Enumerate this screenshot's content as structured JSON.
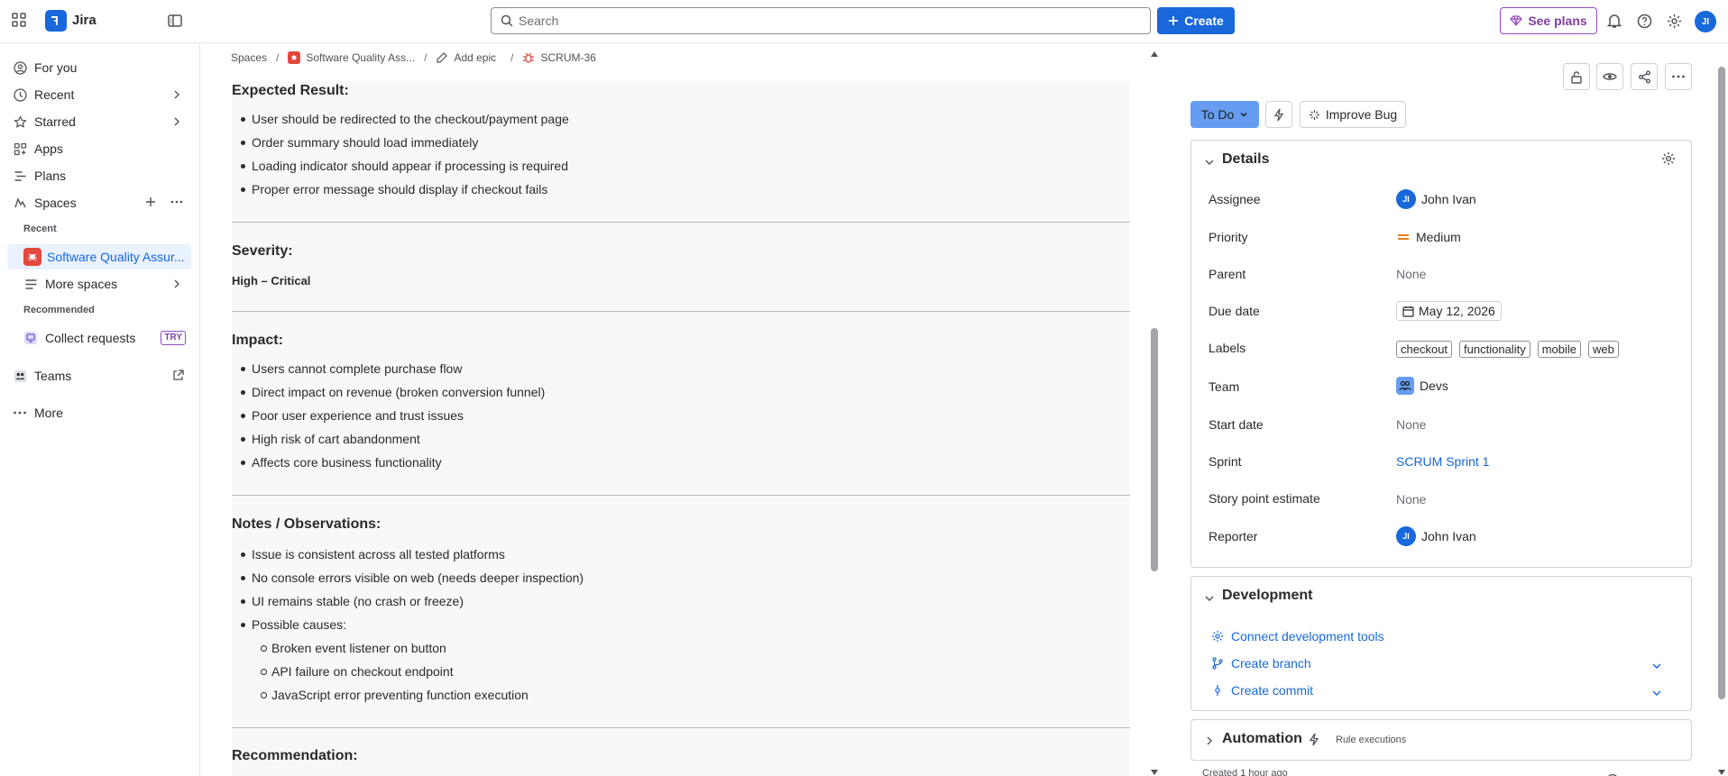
{
  "app": {
    "name": "Jira"
  },
  "topbar": {
    "search_placeholder": "Search",
    "create_label": "Create",
    "plans_label": "See plans",
    "avatar_initials": "JI"
  },
  "sidebar": {
    "for_you": "For you",
    "recent": "Recent",
    "starred": "Starred",
    "apps": "Apps",
    "plans": "Plans",
    "spaces": "Spaces",
    "recent_heading": "Recent",
    "active_space": "Software Quality Assur...",
    "more_spaces": "More spaces",
    "recommended_heading": "Recommended",
    "collect_requests": "Collect requests",
    "try_badge": "TRY",
    "teams": "Teams",
    "more": "More"
  },
  "breadcrumb": {
    "spaces": "Spaces",
    "project": "Software Quality Ass...",
    "epic": "Add epic",
    "issue": "SCRUM-36"
  },
  "description": {
    "expected_title": "Expected Result:",
    "expected": [
      "User should be redirected to the checkout/payment page",
      "Order summary should load immediately",
      "Loading indicator should appear if processing is required",
      "Proper error message should display if checkout fails"
    ],
    "severity_title": "Severity:",
    "severity_value": "High – Critical",
    "impact_title": "Impact:",
    "impact": [
      "Users cannot complete purchase flow",
      "Direct impact on revenue (broken conversion funnel)",
      "Poor user experience and trust issues",
      "High risk of cart abandonment",
      "Affects core business functionality"
    ],
    "notes_title": "Notes / Observations:",
    "notes": [
      "Issue is consistent across all tested platforms",
      "No console errors visible on web (needs deeper inspection)",
      "UI remains stable (no crash or freeze)",
      "Possible causes:"
    ],
    "causes": [
      "Broken event listener on button",
      "API failure on checkout endpoint",
      "JavaScript error preventing function execution"
    ],
    "recommendation_title": "Recommendation:"
  },
  "issue_panel": {
    "status": "To Do",
    "improve_label": "Improve Bug",
    "details_title": "Details",
    "fields": {
      "assignee_label": "Assignee",
      "assignee_value": "John Ivan",
      "assignee_initials": "JI",
      "priority_label": "Priority",
      "priority_value": "Medium",
      "parent_label": "Parent",
      "parent_value": "None",
      "due_label": "Due date",
      "due_value": "May 12, 2026",
      "labels_label": "Labels",
      "labels": [
        "checkout",
        "functionality",
        "mobile",
        "web"
      ],
      "team_label": "Team",
      "team_value": "Devs",
      "start_label": "Start date",
      "start_value": "None",
      "sprint_label": "Sprint",
      "sprint_value": "SCRUM Sprint 1",
      "story_label": "Story point estimate",
      "story_value": "None",
      "reporter_label": "Reporter",
      "reporter_value": "John Ivan",
      "reporter_initials": "JI"
    },
    "development_title": "Development",
    "connect_tools": "Connect development tools",
    "create_branch": "Create branch",
    "create_commit": "Create commit",
    "automation_title": "Automation",
    "rule_executions": "Rule executions",
    "created": "Created 1 hour ago"
  },
  "colors": {
    "brand": "#1868db",
    "status_todo": "#669df1",
    "plans_purple": "#964ac0",
    "project_red": "#e2483d",
    "priority_medium": "#e06c00"
  }
}
